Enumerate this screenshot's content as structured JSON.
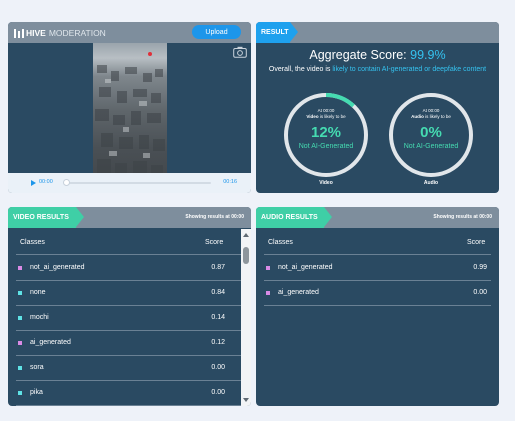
{
  "header": {
    "brand_strong": "HIVE",
    "brand_rest": "MODERATION",
    "upload_label": "Upload"
  },
  "video": {
    "time_current": "00:00",
    "time_total": "00:16",
    "progress_fraction": 0.0
  },
  "result": {
    "tag": "RESULT",
    "aggregate_label": "Aggregate Score:",
    "aggregate_value": "99.9%",
    "overall_prefix": "Overall, the video is",
    "overall_link": "likely to contain AI-generated or deepfake content",
    "gauges": [
      {
        "time": "At 00:00",
        "subject": "Video",
        "likely_suffix": "is likely to be",
        "percent": "12%",
        "percent_value": 12,
        "label": "Not AI-Generated",
        "caption": "Video"
      },
      {
        "time": "At 00:00",
        "subject": "Audio",
        "likely_suffix": "is likely to be",
        "percent": "0%",
        "percent_value": 0,
        "label": "Not AI-Generated",
        "caption": "Audio"
      }
    ]
  },
  "video_results": {
    "tag": "VIDEO RESULTS",
    "note": "Showing results at 00:00",
    "col_classes": "Classes",
    "col_score": "Score",
    "rows": [
      {
        "cls": "not_ai_generated",
        "score": "0.87",
        "color": "#d98be6"
      },
      {
        "cls": "none",
        "score": "0.84",
        "color": "#5fe3e6"
      },
      {
        "cls": "mochi",
        "score": "0.14",
        "color": "#5fe3e6"
      },
      {
        "cls": "ai_generated",
        "score": "0.12",
        "color": "#d98be6"
      },
      {
        "cls": "sora",
        "score": "0.00",
        "color": "#5fe3e6"
      },
      {
        "cls": "pika",
        "score": "0.00",
        "color": "#5fe3e6"
      }
    ]
  },
  "audio_results": {
    "tag": "AUDIO RESULTS",
    "note": "Showing results at 00:00",
    "col_classes": "Classes",
    "col_score": "Score",
    "rows": [
      {
        "cls": "not_ai_generated",
        "score": "0.99",
        "color": "#d98be6"
      },
      {
        "cls": "ai_generated",
        "score": "0.00",
        "color": "#d98be6"
      }
    ]
  },
  "colors": {
    "panel": "#2a4a62",
    "accent_blue": "#1ea1ee",
    "accent_green": "#3fcfa6",
    "gauge_fill": "#45dbb1"
  }
}
